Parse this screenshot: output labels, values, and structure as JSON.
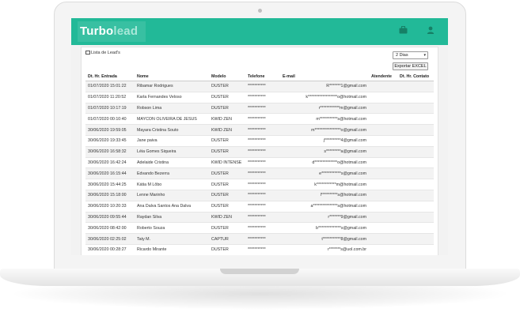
{
  "app": {
    "logo_part1": "Turbo",
    "logo_part2": "lead",
    "icons": [
      "briefcase-icon",
      "user-icon"
    ]
  },
  "panel": {
    "title": "Lista de Lead's",
    "period_selected": "2 Dias",
    "export_label": "Exportar EXCEL"
  },
  "table": {
    "headers": [
      "Dt. Hr. Entrada",
      "Nome",
      "Modelo",
      "Telefone",
      "E-mail",
      "Atendente",
      "Dt. Hr. Contato"
    ],
    "rows": [
      [
        "01/07/2020 15:01:22",
        "Ribamar Rodrigues",
        "DUSTER",
        "***********",
        "R*******1@gmail.com",
        "",
        ""
      ],
      [
        "01/07/2020 11:20:52",
        "Karla Fernandes Veloso",
        "DUSTER",
        "***********",
        "k******************o@hotmail.com",
        "",
        ""
      ],
      [
        "01/07/2020 10:17:19",
        "Robson Lima",
        "DUSTER",
        "***********",
        "r************m@gmail.com",
        "",
        ""
      ],
      [
        "01/07/2020 00:10:40",
        "MAYCON OLIVEIRA DE JESUS",
        "KWID ZEN",
        "***********",
        "m***********s@hotmail.com",
        "",
        ""
      ],
      [
        "30/06/2020 19:59:05",
        "Mayara Cristina Souto",
        "KWID ZEN",
        "***********",
        "m****************o@gmail.com",
        "",
        ""
      ],
      [
        "30/06/2020 19:33:45",
        "Jane paiva",
        "DUSTER",
        "***********",
        "j**********4@gmail.com",
        "",
        ""
      ],
      [
        "30/06/2020 16:58:32",
        "Léia Gomes Siqueira",
        "DUSTER",
        "***********",
        "s*********a@gmail.com",
        "",
        ""
      ],
      [
        "30/06/2020 16:42:24",
        "Adelaide Cristina",
        "KWID INTENSE",
        "***********",
        "d**************o@hotmail.com",
        "",
        ""
      ],
      [
        "30/06/2020 16:15:44",
        "Edvando Bezerra",
        "DUSTER",
        "***********",
        "e************s@gmail.com",
        "",
        ""
      ],
      [
        "30/06/2020 15:44:25",
        "Kátia M Lôbo",
        "DUSTER",
        "***********",
        "k************m@hotmail.com",
        "",
        ""
      ],
      [
        "30/06/2020 15:18:00",
        "Lenne Marinho",
        "DUSTER",
        "***********",
        "l**********s@hotmail.com",
        "",
        ""
      ],
      [
        "30/06/2020 10:20:33",
        "Ana Dalva Santos Ana Dalva",
        "DUSTER",
        "***********",
        "a***************s@hotmail.com",
        "",
        ""
      ],
      [
        "30/06/2020 09:55:44",
        "Raydan Silva",
        "KWID ZEN",
        "***********",
        "r*******9@gmail.com",
        "",
        ""
      ],
      [
        "30/06/2020 08:42:00",
        "Roberto Souza",
        "DUSTER",
        "***********",
        "b**************s@gmail.com",
        "",
        ""
      ],
      [
        "30/06/2020 02:25:02",
        "Taty M.",
        "CAPTUR",
        "***********",
        "t***********8@gmail.com",
        "",
        ""
      ],
      [
        "30/06/2020 00:28:27",
        "Ricardo Mirante",
        "DUSTER",
        "***********",
        "r*******s@uol.com.br",
        "",
        ""
      ],
      [
        "29/06/2020 23:34:51",
        "Elis Alves",
        "DUSTER",
        "***********",
        "e*********o@hotmail.com",
        "",
        ""
      ]
    ]
  }
}
